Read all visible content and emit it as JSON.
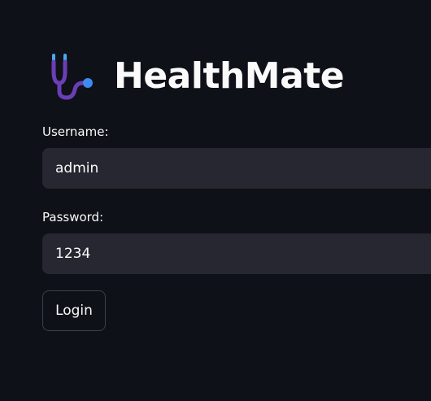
{
  "app": {
    "title": "HealthMate",
    "logo_icon": "stethoscope-icon"
  },
  "form": {
    "username_label": "Username:",
    "username_value": "admin",
    "password_label": "Password:",
    "password_value": "1234",
    "login_label": "Login"
  },
  "colors": {
    "background": "#0e1117",
    "input_bg": "#262730",
    "text": "#fafafa",
    "stethoscope_tube": "#6a3fb5",
    "stethoscope_earpiece": "#4aa8f0",
    "stethoscope_chestpiece": "#3d8bf0"
  }
}
